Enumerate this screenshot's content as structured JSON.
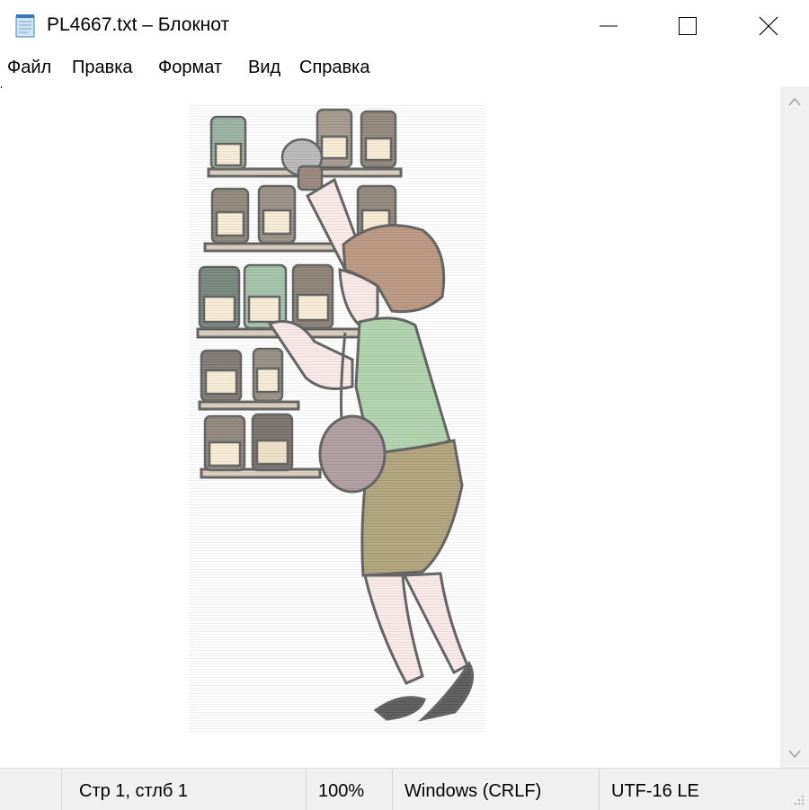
{
  "window": {
    "title": "PL4667.txt – Блокнот"
  },
  "menu": {
    "items": [
      "Файл",
      "Правка",
      "Формат",
      "Вид",
      "Справка"
    ]
  },
  "editor": {
    "content_description": "ASCII-art style illustration: a woman with brown hair, green top, olive skirt and shoulder bag reaching for jars on a spice shelf"
  },
  "status": {
    "position": "Стр 1, стлб 1",
    "zoom": "100%",
    "line_endings": "Windows (CRLF)",
    "encoding": "UTF-16 LE"
  },
  "icons": [
    "notepad-icon",
    "minimize-icon",
    "maximize-icon",
    "close-icon",
    "scroll-up-icon",
    "scroll-down-icon",
    "resize-grip-icon"
  ]
}
